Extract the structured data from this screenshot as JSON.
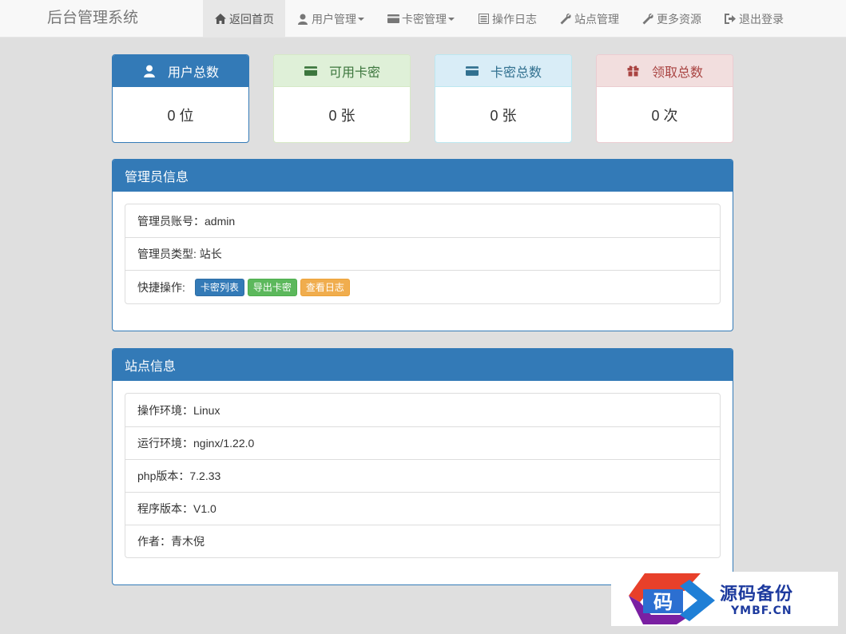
{
  "nav": {
    "brand": "后台管理系统",
    "items": [
      {
        "label": "返回首页",
        "icon": "home-icon",
        "active": true
      },
      {
        "label": "用户管理",
        "icon": "user-icon",
        "dropdown": true
      },
      {
        "label": "卡密管理",
        "icon": "credit-card-icon",
        "dropdown": true
      },
      {
        "label": "操作日志",
        "icon": "list-alt-icon"
      },
      {
        "label": "站点管理",
        "icon": "wrench-icon"
      },
      {
        "label": "更多资源",
        "icon": "wrench-icon"
      },
      {
        "label": "退出登录",
        "icon": "log-out-icon"
      }
    ]
  },
  "stats": [
    {
      "label": "用户总数",
      "value": "0 位",
      "icon": "user-icon",
      "color": "#337ab7"
    },
    {
      "label": "可用卡密",
      "value": "0 张",
      "icon": "credit-card-icon",
      "color": "#3c763d"
    },
    {
      "label": "卡密总数",
      "value": "0 张",
      "icon": "credit-card-icon",
      "color": "#31708f"
    },
    {
      "label": "领取总数",
      "value": "0 次",
      "icon": "gift-icon",
      "color": "#a94442"
    }
  ],
  "admin_panel": {
    "title": "管理员信息",
    "account": "管理员账号：admin",
    "type": "管理员类型: 站长",
    "quick_label": "快捷操作:",
    "buttons": [
      "卡密列表",
      "导出卡密",
      "查看日志"
    ]
  },
  "site_panel": {
    "title": "站点信息",
    "rows": [
      "操作环境：Linux",
      "运行环境：nginx/1.22.0",
      "php版本：7.2.33",
      "程序版本：V1.0",
      "作者：青木倪"
    ]
  },
  "watermark": {
    "logo_char": "码",
    "title": "源码备份",
    "url": "YMBF.CN"
  }
}
